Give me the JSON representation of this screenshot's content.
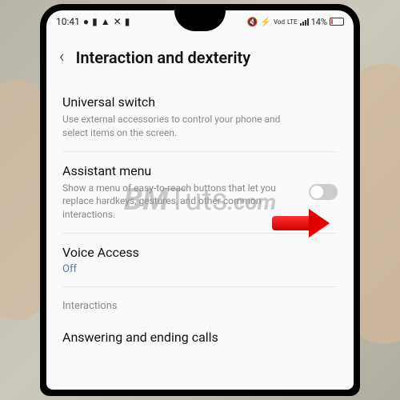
{
  "status": {
    "time": "10:41",
    "carrier": "Vod",
    "network": "LTE",
    "battery": "14%"
  },
  "header": {
    "title": "Interaction and dexterity"
  },
  "settings": {
    "universal_switch": {
      "title": "Universal switch",
      "desc": "Use external accessories to control your phone and select items on the screen."
    },
    "assistant_menu": {
      "title": "Assistant menu",
      "desc": "Show a menu of easy-to-reach buttons that let you replace hardkeys, gestures, and other common interactions."
    },
    "voice_access": {
      "title": "Voice Access",
      "status": "Off"
    },
    "section_interactions": "Interactions",
    "answering_calls": {
      "title": "Answering and ending calls"
    }
  },
  "watermark": "BMTuts.com"
}
